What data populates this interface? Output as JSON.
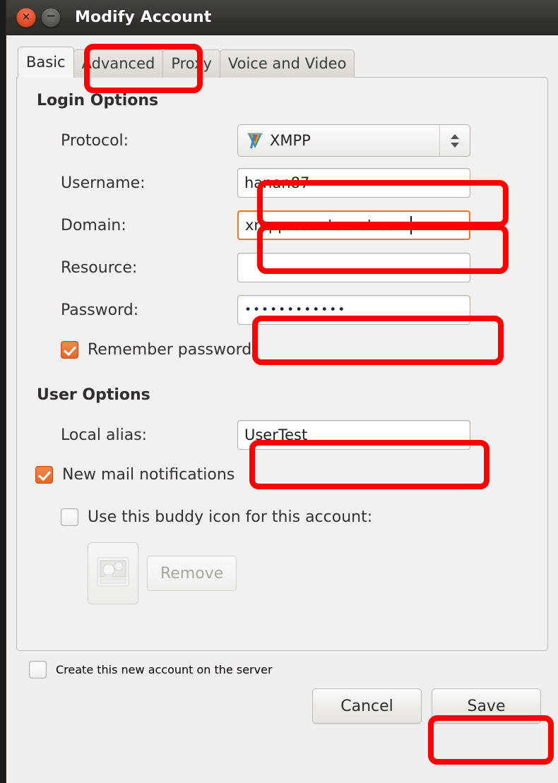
{
  "window": {
    "title": "Modify Account",
    "controls": [
      {
        "name": "close",
        "glyph": "✕"
      },
      {
        "name": "minimize",
        "glyph": "−"
      }
    ]
  },
  "tabs": [
    {
      "label": "Basic",
      "active": true
    },
    {
      "label": "Advanced",
      "active": false
    },
    {
      "label": "Proxy",
      "active": false
    },
    {
      "label": "Voice and Video",
      "active": false
    }
  ],
  "login_options": {
    "section_label": "Login Options",
    "protocol": {
      "label": "Protocol:",
      "value": "XMPP",
      "icon": "xmpp-protocol-icon"
    },
    "username": {
      "label": "Username:",
      "value": "hanan87",
      "placeholder": ""
    },
    "domain": {
      "label": "Domain:",
      "value": "xmpp.counternet.com",
      "placeholder": "",
      "focused": true
    },
    "resource": {
      "label": "Resource:",
      "value": "",
      "placeholder": ""
    },
    "password": {
      "label": "Password:",
      "value": "••••••••••••",
      "placeholder": ""
    },
    "remember_password": {
      "label": "Remember password",
      "checked": true
    }
  },
  "user_options": {
    "section_label": "User Options",
    "local_alias": {
      "label": "Local alias:",
      "value": "UserTest",
      "placeholder": ""
    },
    "new_mail_notifications": {
      "label": "New mail notifications",
      "checked": true
    },
    "use_buddy_icon": {
      "label": "Use this buddy icon for this account:",
      "checked": false
    },
    "buddy_icon_button": {
      "icon": "photo-placeholder-icon"
    },
    "remove_button": {
      "label": "Remove",
      "enabled": false
    }
  },
  "footer": {
    "create_account": {
      "label": "Create this new account on the server",
      "checked": false
    },
    "cancel_button": "Cancel",
    "save_button": "Save"
  },
  "colors": {
    "annotation": "#fe0000",
    "accent_orange": "#e8762b",
    "titlebar": "#3b3935",
    "dialog_bg": "#f0efee"
  },
  "annotations": [
    {
      "target": "tab-advanced"
    },
    {
      "target": "username-field"
    },
    {
      "target": "domain-field"
    },
    {
      "target": "password-field"
    },
    {
      "target": "local-alias-field"
    },
    {
      "target": "save-button"
    }
  ]
}
